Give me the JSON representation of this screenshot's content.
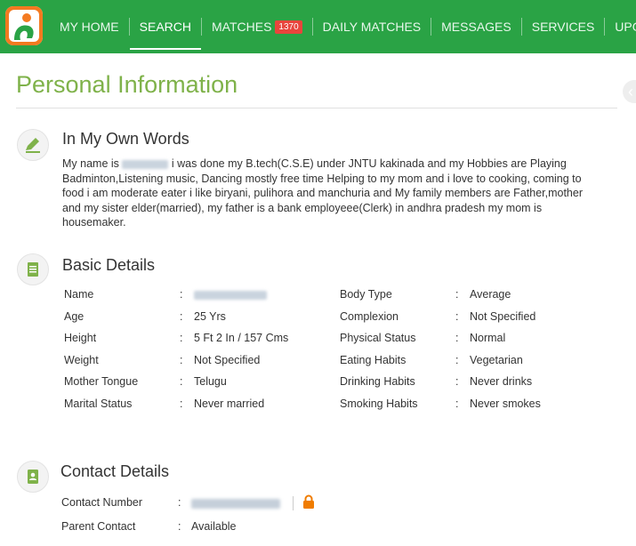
{
  "nav": {
    "items": [
      {
        "label": "MY HOME",
        "active": false
      },
      {
        "label": "SEARCH",
        "active": true
      },
      {
        "label": "MATCHES",
        "badge": "1370",
        "active": false
      },
      {
        "label": "DAILY MATCHES",
        "active": false
      },
      {
        "label": "MESSAGES",
        "active": false
      },
      {
        "label": "SERVICES",
        "active": false
      },
      {
        "label": "UPGRA",
        "active": false
      }
    ]
  },
  "page": {
    "title": "Personal Information"
  },
  "own_words": {
    "title": "In My Own Words",
    "prefix": "My name is",
    "text": "i was done my B.tech(C.S.E) under JNTU kakinada and my Hobbies are Playing Badminton,Listening music, Dancing mostly free time Helping to my mom and i love to cooking, coming to food i am moderate eater i like biryani, pulihora and manchuria and My family members are Father,mother and my sister elder(married), my father is a bank employeee(Clerk) in andhra pradesh my mom is housemaker."
  },
  "basic": {
    "title": "Basic Details",
    "rows": [
      {
        "l_label": "Name",
        "l_value": "",
        "r_label": "Body Type",
        "r_value": "Average"
      },
      {
        "l_label": "Age",
        "l_value": "25 Yrs",
        "r_label": "Complexion",
        "r_value": "Not Specified"
      },
      {
        "l_label": "Height",
        "l_value": "5 Ft 2 In / 157 Cms",
        "r_label": "Physical Status",
        "r_value": "Normal"
      },
      {
        "l_label": "Weight",
        "l_value": "Not Specified",
        "r_label": "Eating Habits",
        "r_value": "Vegetarian"
      },
      {
        "l_label": "Mother Tongue",
        "l_value": "Telugu",
        "r_label": "Drinking Habits",
        "r_value": "Never drinks"
      },
      {
        "l_label": "Marital Status",
        "l_value": "Never married",
        "r_label": "Smoking Habits",
        "r_value": "Never smokes"
      }
    ]
  },
  "contact": {
    "title": "Contact Details",
    "number_label": "Contact Number",
    "parent_label": "Parent Contact",
    "parent_value": "Available"
  },
  "colors": {
    "brand_green": "#2aa345",
    "title_green": "#7fb24a",
    "badge_red": "#e8453c",
    "lock_orange": "#f07c00"
  }
}
